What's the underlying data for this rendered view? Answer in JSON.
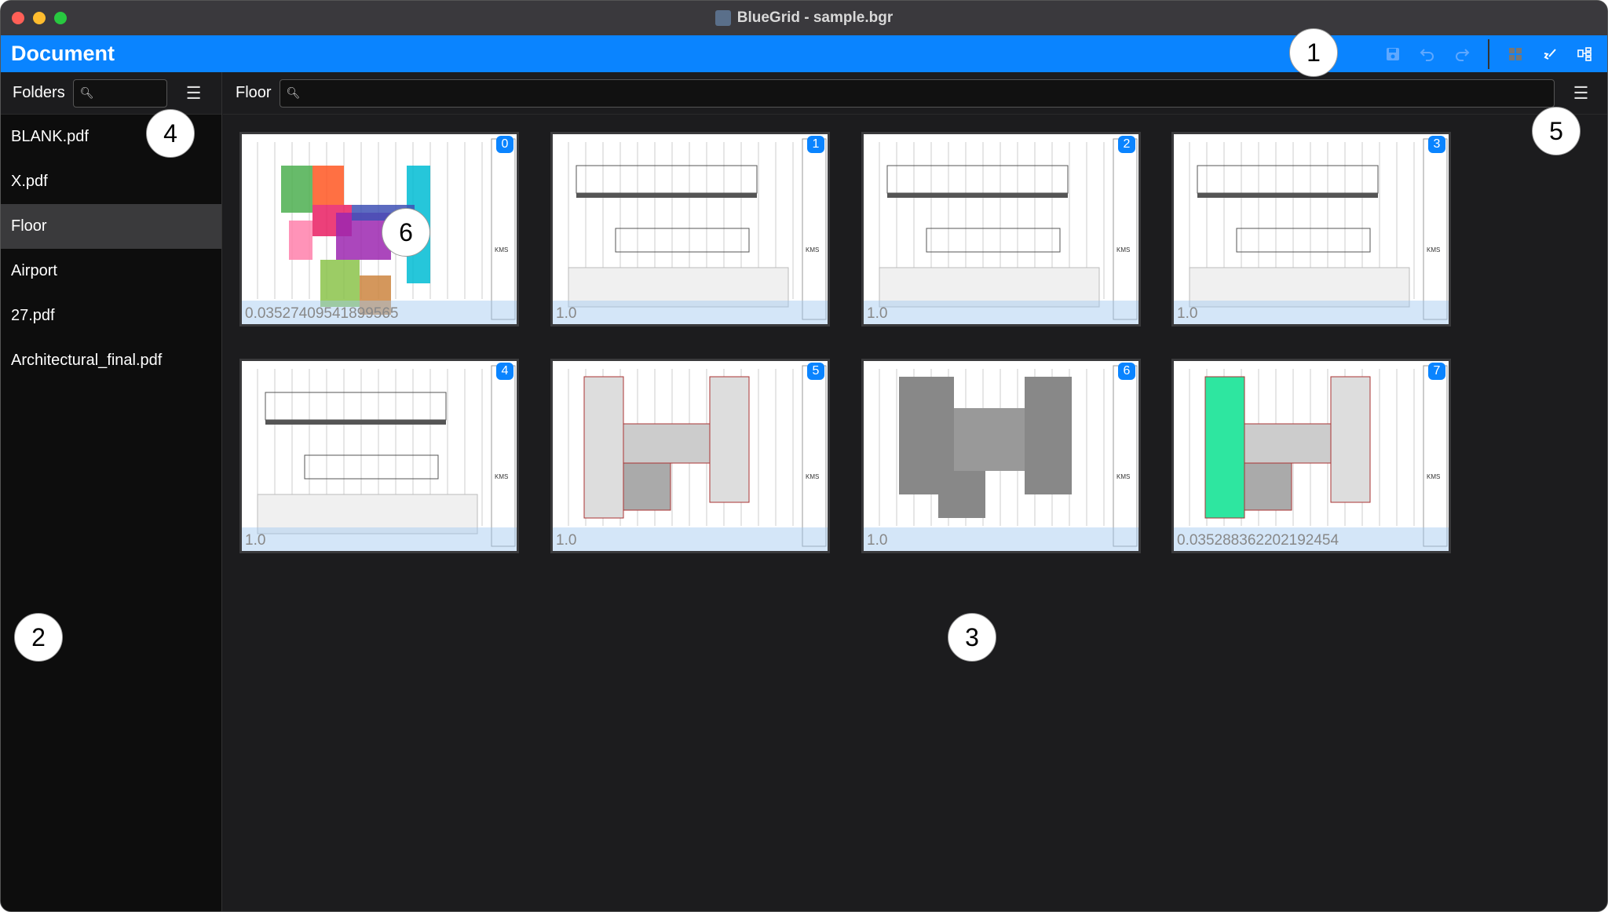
{
  "window": {
    "title": "BlueGrid - sample.bgr"
  },
  "header": {
    "title": "Document",
    "tools": [
      "save-icon",
      "undo-icon",
      "redo-icon",
      "grid-view-icon",
      "annotate-icon",
      "hierarchy-icon"
    ],
    "accent": "#0a84ff"
  },
  "sidebar": {
    "label": "Folders",
    "search_placeholder": "",
    "items": [
      {
        "label": "BLANK.pdf"
      },
      {
        "label": "X.pdf"
      },
      {
        "label": "Floor",
        "selected": true
      },
      {
        "label": "Airport"
      },
      {
        "label": "27.pdf"
      },
      {
        "label": "Architectural_final.pdf"
      }
    ]
  },
  "main": {
    "label": "Floor",
    "search_placeholder": "",
    "thumbnails": [
      {
        "index": "0",
        "scale": "0.03527409541899565",
        "kind": "color-plan"
      },
      {
        "index": "1",
        "scale": "1.0",
        "kind": "elevation"
      },
      {
        "index": "2",
        "scale": "1.0",
        "kind": "elevation"
      },
      {
        "index": "3",
        "scale": "1.0",
        "kind": "elevation"
      },
      {
        "index": "4",
        "scale": "1.0",
        "kind": "elevation"
      },
      {
        "index": "5",
        "scale": "1.0",
        "kind": "plan"
      },
      {
        "index": "6",
        "scale": "1.0",
        "kind": "gray-plan"
      },
      {
        "index": "7",
        "scale": "0.035288362202192454",
        "kind": "green-plan"
      }
    ]
  },
  "callouts": [
    "1",
    "2",
    "3",
    "4",
    "5",
    "6"
  ]
}
